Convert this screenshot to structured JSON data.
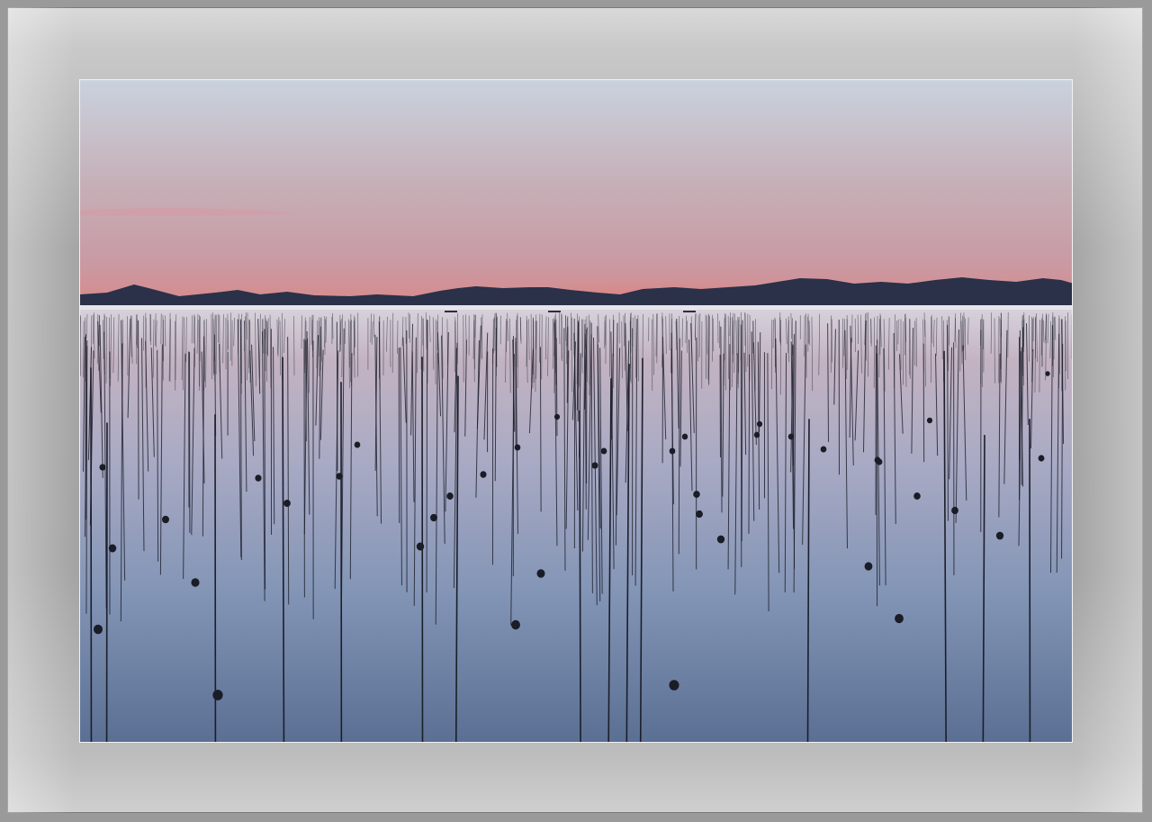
{
  "scene": {
    "subject": "seaweed-farm-poles-at-dusk",
    "colors": {
      "sky_top": "#c9d2de",
      "sky_mid": "#c5aab3",
      "sky_horizon": "#d88a8a",
      "mountains": "#2a3148",
      "water_far": "#c8b9c7",
      "water_mid": "#8f9fbd",
      "water_near": "#5d7396",
      "poles": "#1c1e2a",
      "mat_light": "#d9d9d9",
      "mat_dark": "#a4a4a4"
    }
  }
}
